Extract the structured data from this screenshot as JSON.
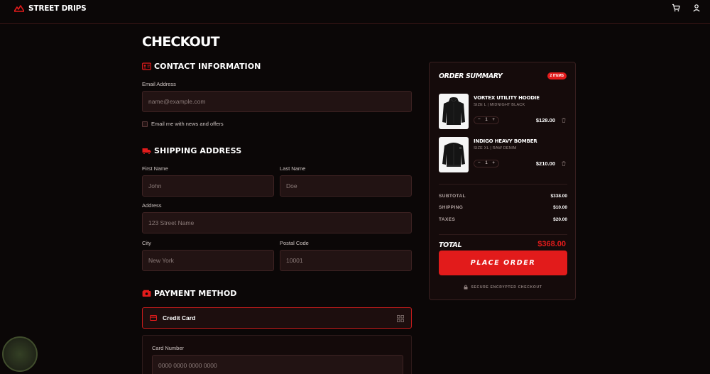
{
  "header": {
    "brand": "STREET DRIPS",
    "icons": [
      "logo-mark-icon",
      "cart-icon",
      "user-icon"
    ]
  },
  "checkout": {
    "title": "CHECKOUT",
    "contact": {
      "title": "CONTACT INFORMATION",
      "email_label": "Email Address",
      "email_placeholder": "name@example.com",
      "newsletter_label": "Email me with news and offers"
    },
    "shipping": {
      "title": "SHIPPING ADDRESS",
      "first_name_label": "First Name",
      "first_name_placeholder": "John",
      "last_name_label": "Last Name",
      "last_name_placeholder": "Doe",
      "address_label": "Address",
      "address_placeholder": "123 Street Name",
      "city_label": "City",
      "city_placeholder": "New York",
      "postal_label": "Postal Code",
      "postal_placeholder": "10001"
    },
    "payment": {
      "title": "PAYMENT METHOD",
      "selected_method": "Credit Card",
      "card_number_label": "Card Number",
      "card_number_placeholder": "0000 0000 0000 0000"
    }
  },
  "summary": {
    "title": "ORDER SUMMARY",
    "badge": "2 ITEMS",
    "items": [
      {
        "name": "VORTEX UTILITY HOODIE",
        "meta": "SIZE L | MIDNIGHT BLACK",
        "qty": "1",
        "minus": "−",
        "plus": "+",
        "price": "$128.00"
      },
      {
        "name": "INDIGO HEAVY BOMBER",
        "meta": "SIZE XL | RAW DENIM",
        "qty": "1",
        "minus": "−",
        "plus": "+",
        "price": "$210.00"
      }
    ],
    "subtotal_label": "SUBTOTAL",
    "subtotal": "$338.00",
    "shipping_label": "SHIPPING",
    "shipping": "$10.00",
    "taxes_label": "TAXES",
    "taxes": "$20.00",
    "total_label": "TOTAL",
    "total": "$368.00",
    "cta": "PLACE ORDER",
    "secure_note": "SECURE ENCRYPTED CHECKOUT"
  },
  "colors": {
    "accent": "#e21b1b",
    "background": "#0b0707",
    "panel": "#150b0b",
    "field": "#221313"
  }
}
